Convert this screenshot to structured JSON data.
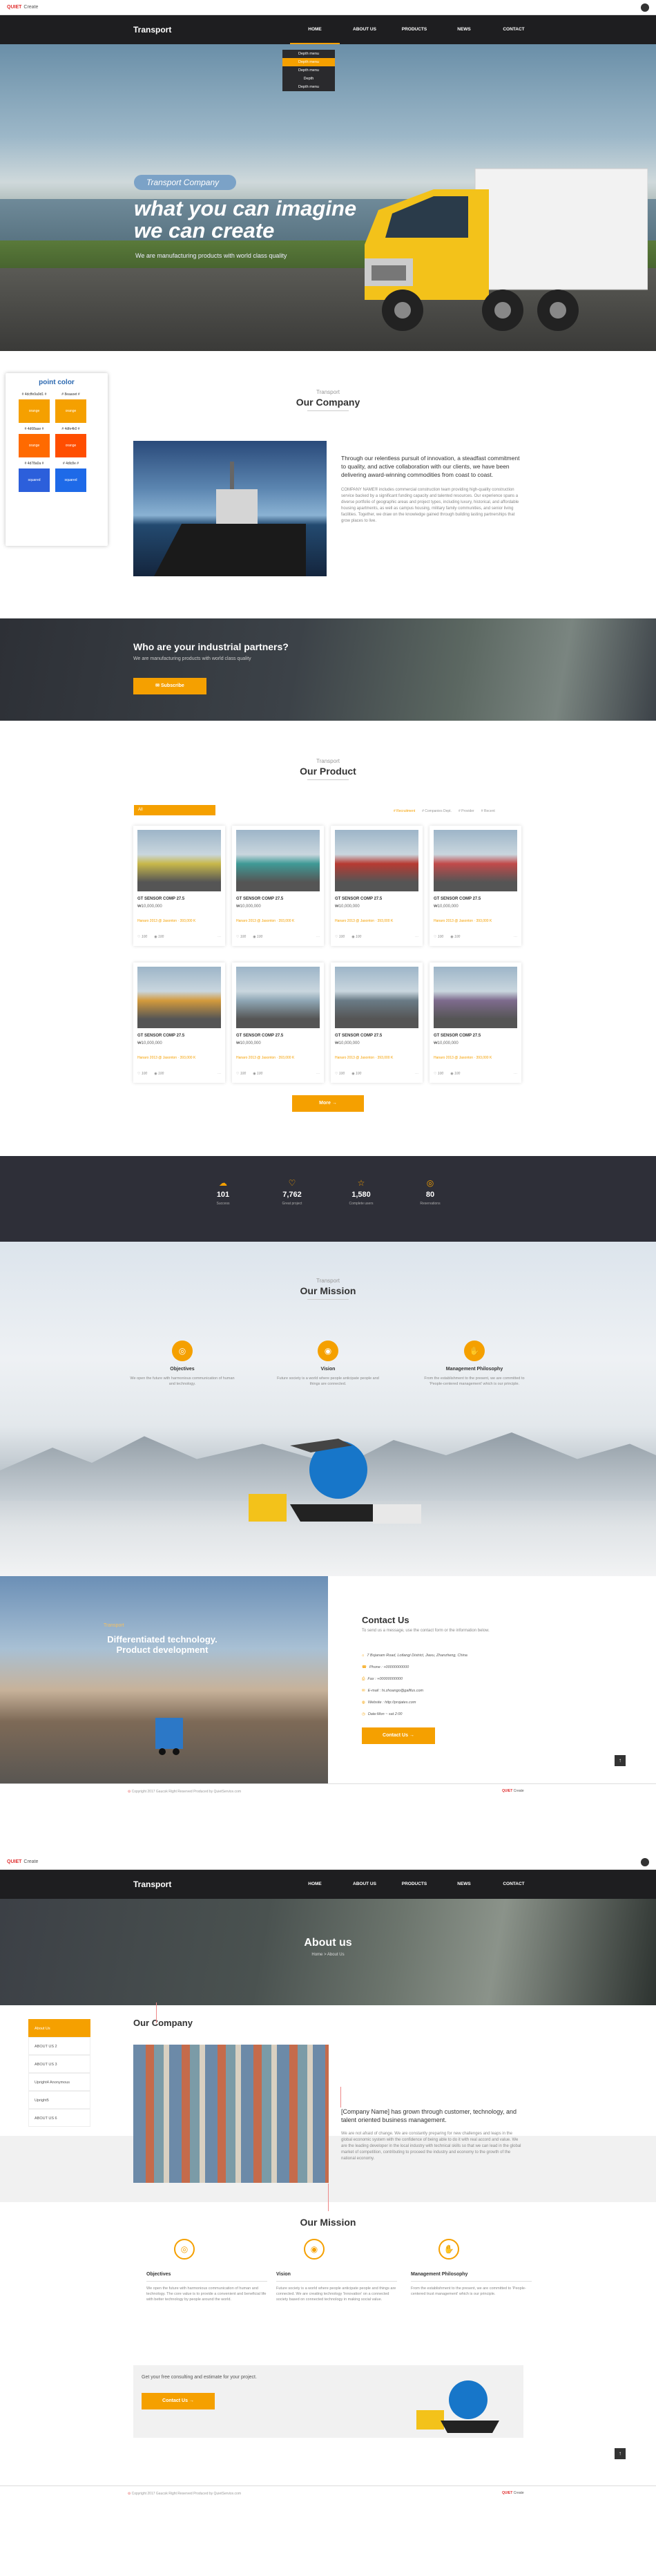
{
  "brand": {
    "name_red": "QUIET",
    "name_rest": "Create",
    "logo": "Transport"
  },
  "nav": [
    "HOME",
    "ABOUT US",
    "PRODUCTS",
    "NEWS",
    "CONTACT"
  ],
  "dropdown": [
    "Depth menu",
    "Depth menu",
    "Depth menu",
    "Depth",
    "Depth menu"
  ],
  "hero": {
    "tag": "Transport Company",
    "title1": "what you can imagine",
    "title2": "we can create",
    "sub": "We are manufacturing products with world class quality"
  },
  "point": {
    "title": "point color",
    "labels": [
      "# 4dcffe9a9d1 #",
      "# 8eaaoet #",
      "# 4d68aae #",
      "# 4dfe4k0 #",
      "# 4d78a0a #",
      "# 4dlc8e #"
    ],
    "swatches": [
      {
        "label": "orange",
        "color": "#f5a000"
      },
      {
        "label": "orange",
        "color": "#f5a000"
      },
      {
        "label": "orange",
        "color": "#ff6a00"
      },
      {
        "label": "orange",
        "color": "#ff4e00"
      },
      {
        "label": "squared",
        "color": "#2c5fdb"
      },
      {
        "label": "squared",
        "color": "#1e6ae8"
      }
    ]
  },
  "company": {
    "small": "Transport",
    "title": "Our Company",
    "lead": "Through our relentless pursuit of innovation, a steadfast commitment to quality, and active collaboration with our clients, we have been delivering award-winning commodities from coast to coast.",
    "body": "COMPANY NAME® includes commercial construction team providing high-quality construction service backed by a significant funding capacity and talented resources. Our experience spans a diverse portfolio of geographic areas and project types, including luxury, historical, and affordable housing apartments, as well as campus housing, military family communities, and senior living facilities. Together, we draw on the knowledge gained through building lasting partnerships that grow places to live."
  },
  "partners": {
    "title": "Who are your industrial partners?",
    "sub": "We are manufacturing products with world class quality",
    "button": "Subscribe"
  },
  "product": {
    "small": "Transport",
    "title": "Our Product",
    "filter": "All",
    "tabs": [
      "# Recruitment",
      "# Companies Dept.",
      "# Provider",
      "# Recent"
    ],
    "more": "More",
    "cards": [
      {
        "title": "GT SENSOR COMP 27.5",
        "price": "₩10,000,000",
        "meta": "Hanaro 2013 @ Jasonton · 393,000 K",
        "likes": "100",
        "views": "100",
        "img": "#c8b84a"
      },
      {
        "title": "GT SENSOR COMP 27.5",
        "price": "₩10,000,000",
        "meta": "Hanaro 2013 @ Jasonton · 393,000 K",
        "likes": "100",
        "views": "100",
        "img": "#3f9a96"
      },
      {
        "title": "GT SENSOR COMP 27.5",
        "price": "₩10,000,000",
        "meta": "Hanaro 2013 @ Jasonton · 393,000 K",
        "likes": "100",
        "views": "100",
        "img": "#b73a32"
      },
      {
        "title": "GT SENSOR COMP 27.5",
        "price": "₩10,000,000",
        "meta": "Hanaro 2013 @ Jasonton · 393,000 K",
        "likes": "100",
        "views": "100",
        "img": "#c14a4a"
      },
      {
        "title": "GT SENSOR COMP 27.5",
        "price": "₩10,000,000",
        "meta": "Hanaro 2013 @ Jasonton · 393,000 K",
        "likes": "100",
        "views": "100",
        "img": "#d39a3c"
      },
      {
        "title": "GT SENSOR COMP 27.5",
        "price": "₩10,000,000",
        "meta": "Hanaro 2013 @ Jasonton · 393,000 K",
        "likes": "100",
        "views": "100",
        "img": "#8fa7b5"
      },
      {
        "title": "GT SENSOR COMP 27.5",
        "price": "₩10,000,000",
        "meta": "Hanaro 2013 @ Jasonton · 393,000 K",
        "likes": "100",
        "views": "100",
        "img": "#6a7b86"
      },
      {
        "title": "GT SENSOR COMP 27.5",
        "price": "₩10,000,000",
        "meta": "Hanaro 2013 @ Jasonton · 393,000 K",
        "likes": "100",
        "views": "100",
        "img": "#7e6b8d"
      }
    ]
  },
  "stats": [
    {
      "icon": "☁",
      "n": "101",
      "l": "Success"
    },
    {
      "icon": "♡",
      "n": "7,762",
      "l": "Great project"
    },
    {
      "icon": "☆",
      "n": "1,580",
      "l": "Complete users"
    },
    {
      "icon": "◎",
      "n": "80",
      "l": "Reservations"
    }
  ],
  "mission": {
    "small": "Transport",
    "title": "Our Mission",
    "cols": [
      {
        "h": "Objectives",
        "p": "We open the future with harmonious communication of human and technology."
      },
      {
        "h": "Vision",
        "p": "Future society is a world where people anticipate people and things are connected."
      },
      {
        "h": "Management Philosophy",
        "p": "From the establishment to the present, we are committed to 'People-centered management' which is our principle."
      }
    ]
  },
  "contact": {
    "small": "Transport",
    "title1": "Differentiated technology.",
    "title2": "Product development",
    "heading": "Contact Us",
    "sub": "To send us a message, use the contact form or the information below.",
    "lines": [
      "7 Bojanam Road, Lotlangi District, Jiaxu, Zhanzheng, China",
      "Phone : +00000000000",
      "Fax : +00000000000",
      "E-mail : hi.zhoango@gallfus.com",
      "Website : http://projates.com",
      "Date:Mon ~ sat 2:00"
    ],
    "button": "Contact Us"
  },
  "footer": {
    "copy": "Copyright 2017 Gaucsk Right Reserved Produced by QuietService.com",
    "brand_red": "QUIET",
    "brand_rest": "Create"
  },
  "about": {
    "title": "About us",
    "crumb": "Home > About Us",
    "side": [
      "About Us",
      "ABOUT US 2",
      "ABOUT US 3",
      "Upright4 Anonymous",
      "Upright5",
      "ABOUT US 6"
    ],
    "company_title": "Our Company",
    "lead": "[Company Name] has grown through customer, technology, and talent oriented business management.",
    "body": "We are not afraid of change. We are constantly preparing for new challenges and leaps in the global economic system with the confidence of being able to do it with real accord and value. We are the leading developer in the local industry with technical skills so that we can lead in the global market of competition, contributing to proceed the industry and economy to the growth of the national economy.",
    "mission_title": "Our Mission",
    "cols": [
      {
        "h": "Objectives",
        "p": "We open the future with harmonious communication of human and technology. The core value is to provide a convenient and beneficial life with better technology by people around the world."
      },
      {
        "h": "Vision",
        "p": "Future society is a world where people anticipate people and things are connected. We are creating technology 'Innovation' on a connected society based on connected technology in making social value."
      },
      {
        "h": "Management Philosophy",
        "p": "From the establishment to the present, we are committed to 'People-centered trust management' which is our principle."
      }
    ],
    "consult": "Get your free consulting and estimate for your project.",
    "button": "Contact Us"
  }
}
